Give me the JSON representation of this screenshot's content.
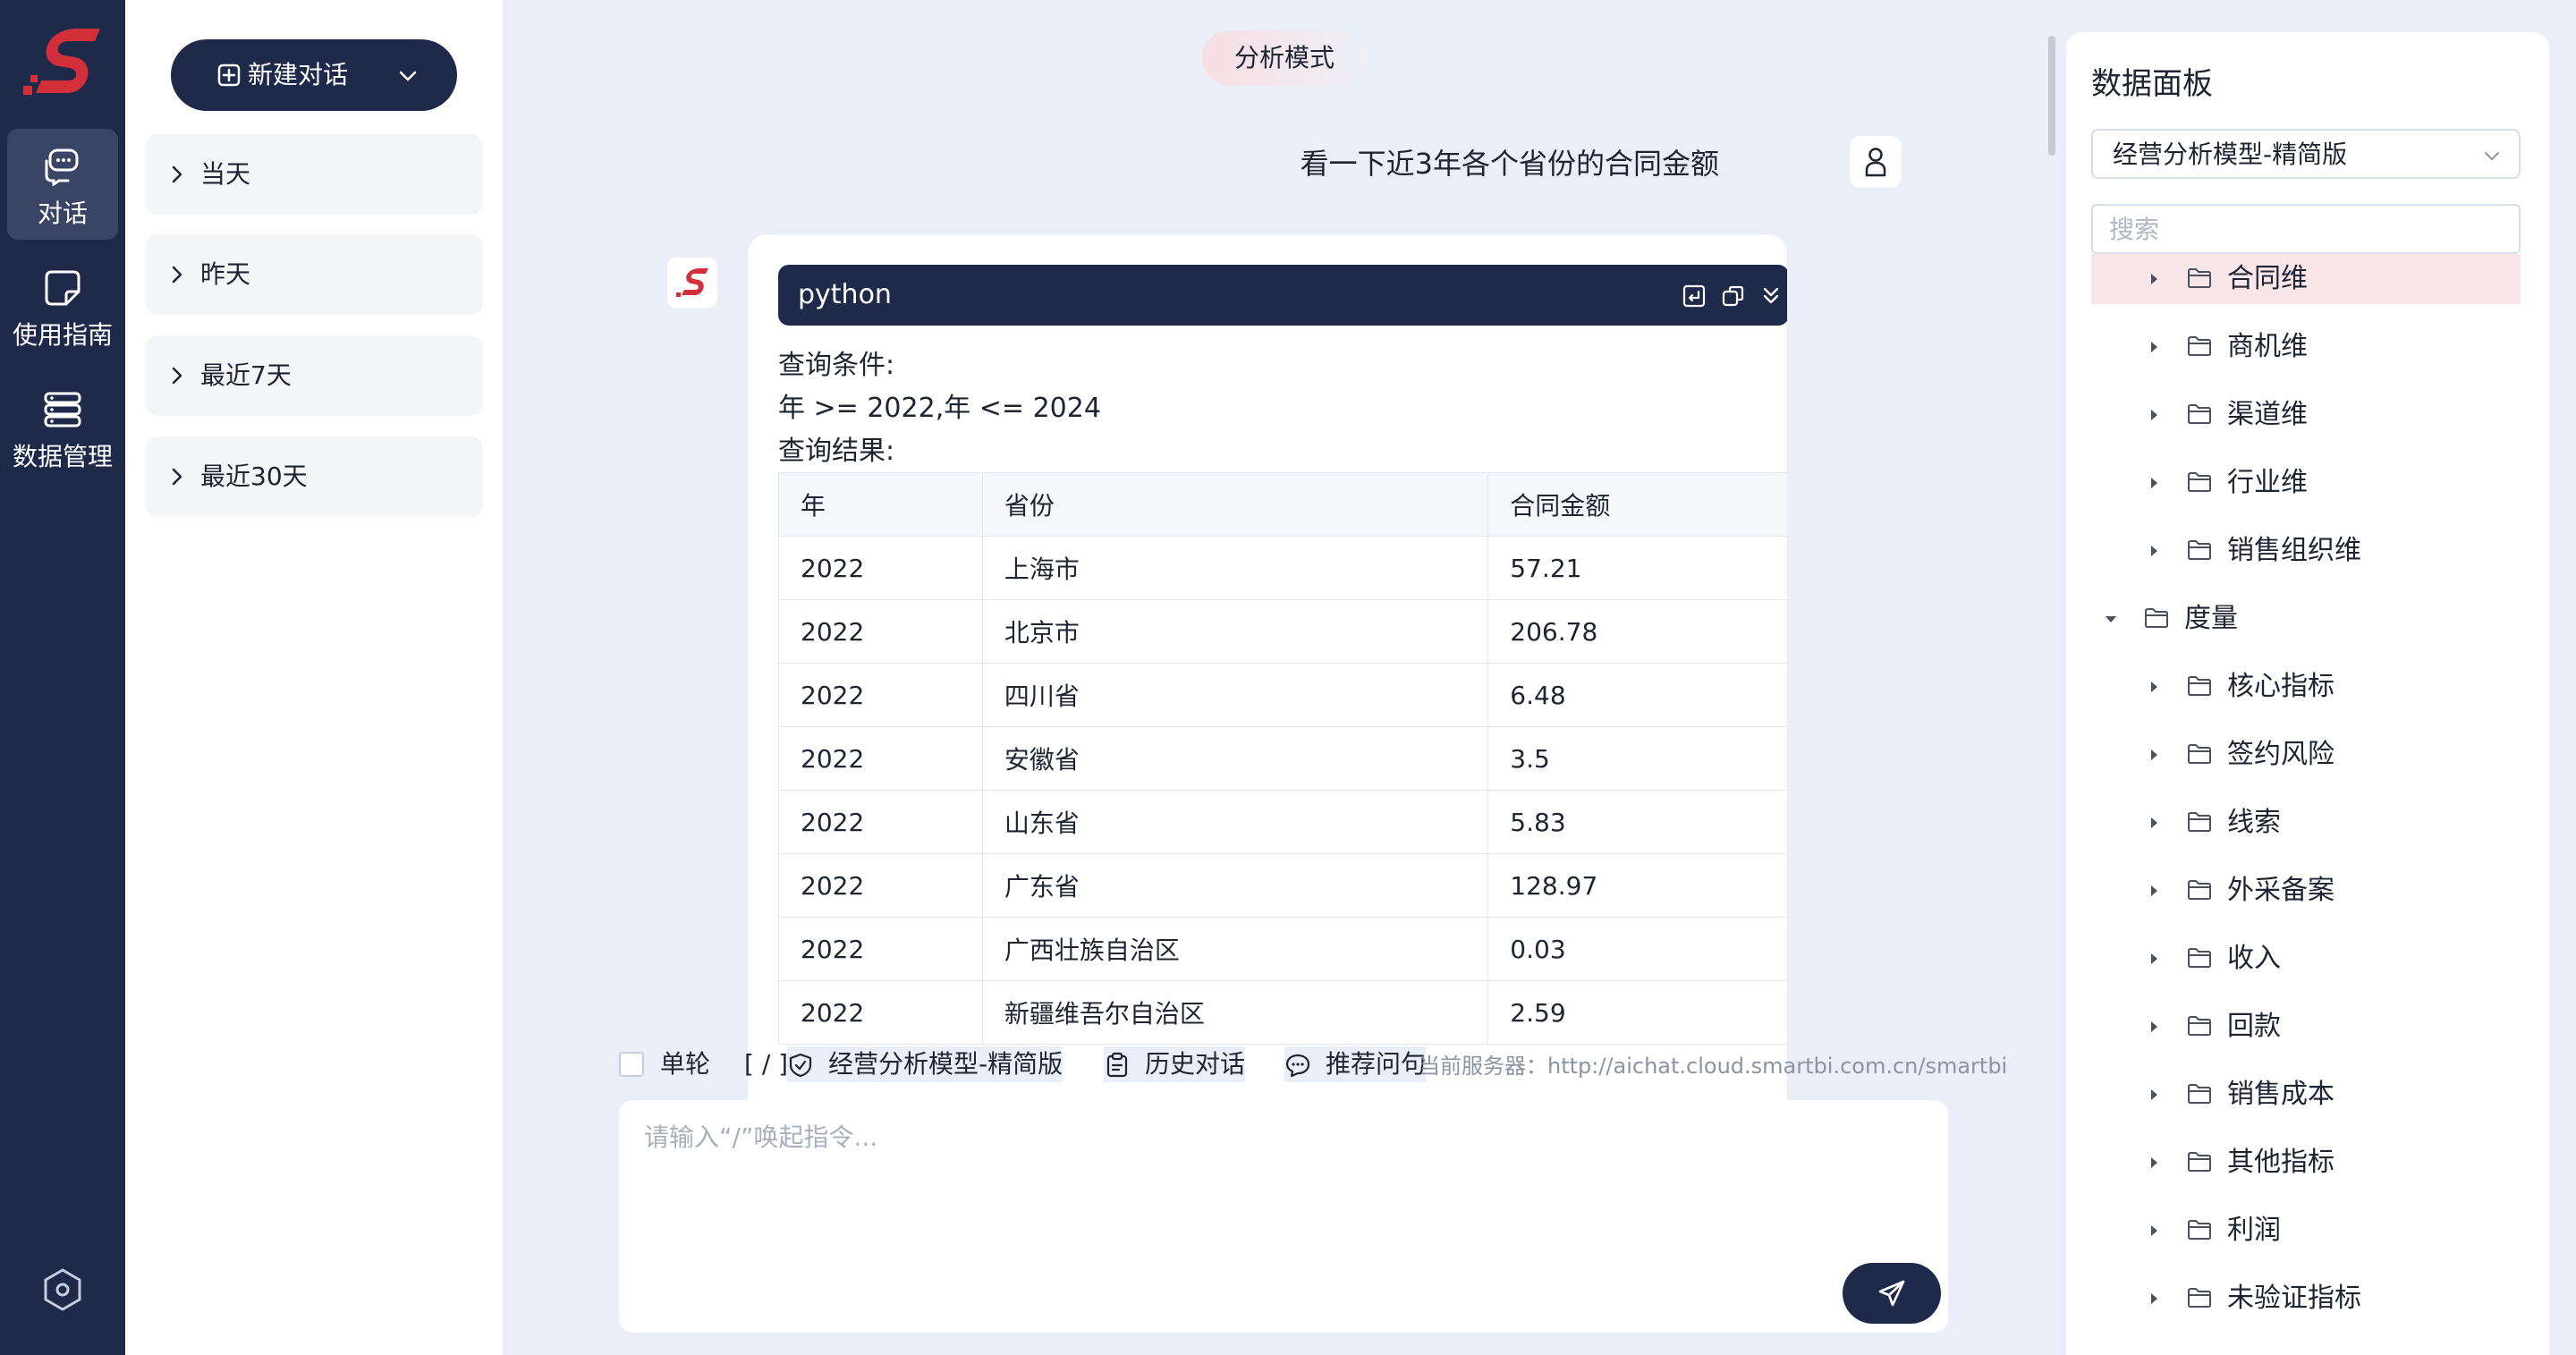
{
  "rail": {
    "items": [
      {
        "label": "对话",
        "icon": "chat-bubbles-icon"
      },
      {
        "label": "使用指南",
        "icon": "guide-icon"
      },
      {
        "label": "数据管理",
        "icon": "server-icon"
      }
    ],
    "settings_icon": "settings-hexagon-icon"
  },
  "history": {
    "new_chat_label": "新建对话",
    "groups": [
      "当天",
      "昨天",
      "最近7天",
      "最近30天"
    ]
  },
  "chat": {
    "mode": "分析模式",
    "user_question": "看一下近3年各个省份的合同金额",
    "answer": {
      "code_lang": "python",
      "condition_label": "查询条件:",
      "condition": "年 >= 2022,年 <= 2024",
      "result_label": "查询结果:",
      "table": {
        "headers": [
          "年",
          "省份",
          "合同金额"
        ],
        "rows": [
          [
            "2022",
            "上海市",
            "57.21"
          ],
          [
            "2022",
            "北京市",
            "206.78"
          ],
          [
            "2022",
            "四川省",
            "6.48"
          ],
          [
            "2022",
            "安徽省",
            "3.5"
          ],
          [
            "2022",
            "山东省",
            "5.83"
          ],
          [
            "2022",
            "广东省",
            "128.97"
          ],
          [
            "2022",
            "广西壮族自治区",
            "0.03"
          ],
          [
            "2022",
            "新疆维吾尔自治区",
            "2.59"
          ]
        ]
      }
    },
    "toolbar": {
      "single_turn": "单轮",
      "slash": "[ / ]",
      "model": "经营分析模型-精简版",
      "history": "历史对话",
      "recommend": "推荐问句",
      "server": "当前服务器：http://aichat.cloud.smartbi.com.cn/smartbi"
    },
    "input_placeholder": "请输入“/”唤起指令..."
  },
  "panel": {
    "title": "数据面板",
    "model_selected": "经营分析模型-精简版",
    "search_placeholder": "搜索",
    "tree": [
      {
        "label": "合同维",
        "level": 1,
        "expanded": false,
        "selected": true
      },
      {
        "label": "商机维",
        "level": 1,
        "expanded": false,
        "selected": false
      },
      {
        "label": "渠道维",
        "level": 1,
        "expanded": false,
        "selected": false
      },
      {
        "label": "行业维",
        "level": 1,
        "expanded": false,
        "selected": false
      },
      {
        "label": "销售组织维",
        "level": 1,
        "expanded": false,
        "selected": false
      },
      {
        "label": "度量",
        "level": 0,
        "expanded": true,
        "selected": false
      },
      {
        "label": "核心指标",
        "level": 1,
        "expanded": false,
        "selected": false
      },
      {
        "label": "签约风险",
        "level": 1,
        "expanded": false,
        "selected": false
      },
      {
        "label": "线索",
        "level": 1,
        "expanded": false,
        "selected": false
      },
      {
        "label": "外采备案",
        "level": 1,
        "expanded": false,
        "selected": false
      },
      {
        "label": "收入",
        "level": 1,
        "expanded": false,
        "selected": false
      },
      {
        "label": "回款",
        "level": 1,
        "expanded": false,
        "selected": false
      },
      {
        "label": "销售成本",
        "level": 1,
        "expanded": false,
        "selected": false
      },
      {
        "label": "其他指标",
        "level": 1,
        "expanded": false,
        "selected": false
      },
      {
        "label": "利润",
        "level": 1,
        "expanded": false,
        "selected": false
      },
      {
        "label": "未验证指标",
        "level": 1,
        "expanded": false,
        "selected": false
      }
    ]
  },
  "colors": {
    "nav": "#1f2a4a",
    "brand_red": "#d32f3a",
    "selected_row": "#f9e6e8",
    "background": "#e9eef8"
  }
}
